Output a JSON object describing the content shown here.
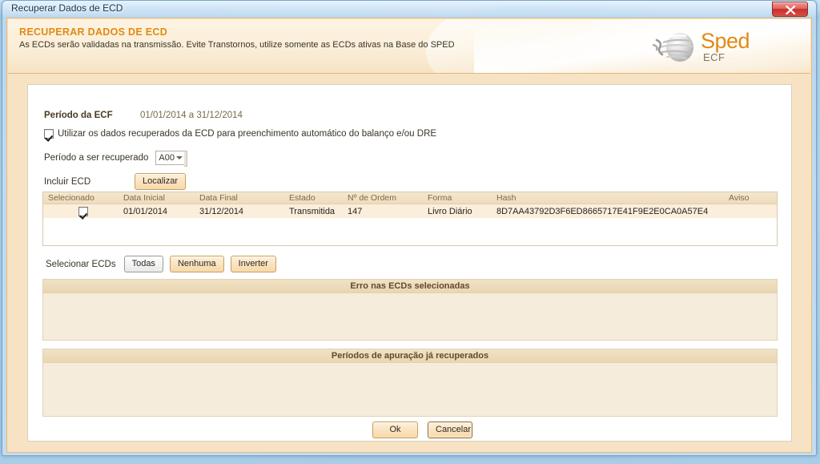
{
  "window": {
    "title": "Recuperar Dados de ECD",
    "close_icon": "close-icon"
  },
  "banner": {
    "title": "RECUPERAR DADOS DE ECD",
    "subtitle": "As ECDs serão validadas na transmissão. Evite Transtornos, utilize somente as ECDs ativas na Base do SPED",
    "logo_text": "Sped",
    "logo_sub": "ECF",
    "logo_icon": "sped-sphere-icon",
    "accent_color": "#e08a14"
  },
  "form": {
    "period_label": "Período da ECF",
    "period_value": "01/01/2014 a 31/12/2014",
    "autofill_label": "Utilizar os dados recuperados da ECD para preenchimento automático do balanço e/ou DRE",
    "autofill_checked": true,
    "recover_period_label": "Período a ser recuperado",
    "recover_period_value": "A00",
    "include_ecd_label": "Incluir ECD",
    "locate_button": "Localizar"
  },
  "table": {
    "columns": [
      "Selecionado",
      "Data Inicial",
      "Data Final",
      "Estado",
      "Nº de Ordem",
      "Forma",
      "Hash",
      "Aviso"
    ],
    "rows": [
      {
        "selected": true,
        "data_inicial": "01/01/2014",
        "data_final": "31/12/2014",
        "estado": "Transmitida",
        "numero_ordem": "147",
        "forma": "Livro Diário",
        "hash": "8D7AA43792D3F6ED8665717E41F9E2E0CA0A57E4",
        "aviso": ""
      }
    ]
  },
  "selection": {
    "label": "Selecionar ECDs",
    "all_button": "Todas",
    "none_button": "Nenhuma",
    "invert_button": "Inverter"
  },
  "errors_box": {
    "title": "Erro nas ECDs selecionadas",
    "content": ""
  },
  "periods_box": {
    "title": "Períodos de apuração já recuperados",
    "content": ""
  },
  "footer": {
    "ok_button": "Ok",
    "cancel_button": "Cancelar"
  }
}
